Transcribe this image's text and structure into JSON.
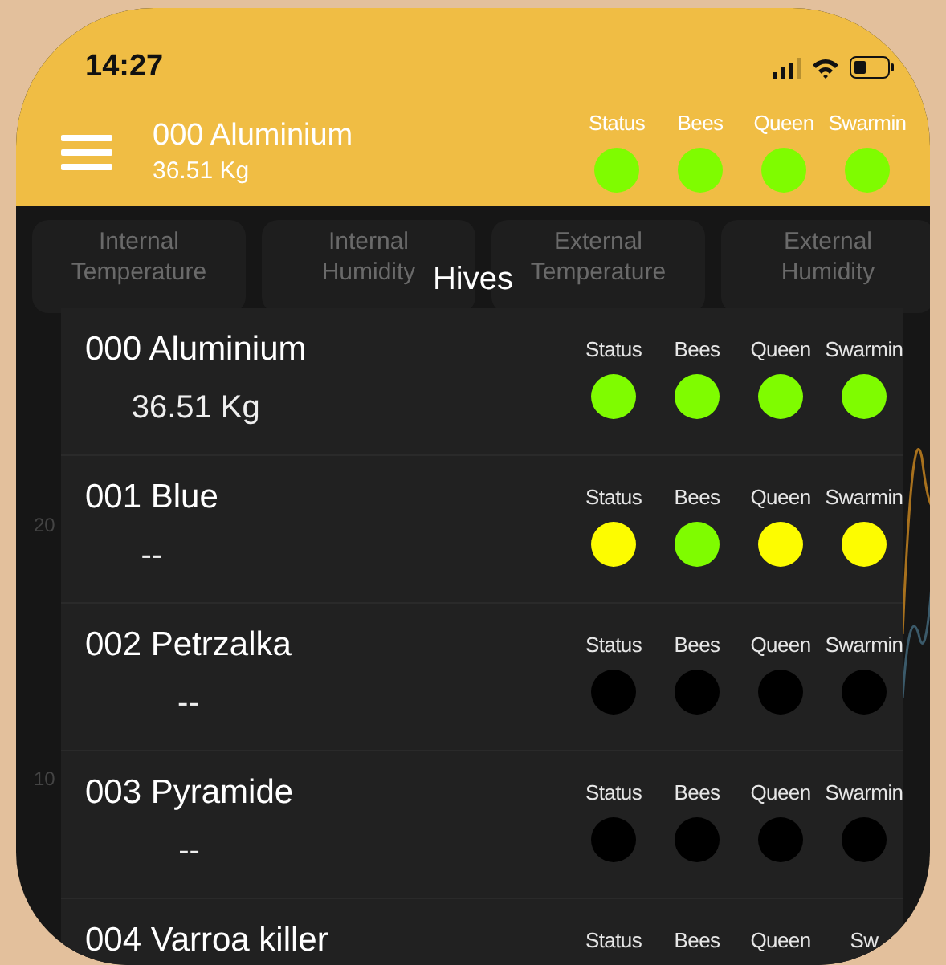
{
  "status_bar": {
    "time": "14:27"
  },
  "header": {
    "hive_name": "000 Aluminium",
    "weight": "36.51 Kg",
    "indicators": [
      {
        "label": "Status",
        "color": "#7ffc00"
      },
      {
        "label": "Bees",
        "color": "#7ffc00"
      },
      {
        "label": "Queen",
        "color": "#7ffc00"
      },
      {
        "label": "Swarmin",
        "color": "#7ffc00"
      }
    ]
  },
  "sensor_cards": [
    {
      "label": "Internal Temperature"
    },
    {
      "label": "Internal Humidity"
    },
    {
      "label": "External Temperature"
    },
    {
      "label": "External Humidity"
    }
  ],
  "chart": {
    "axis_labels": [
      "20",
      "10"
    ]
  },
  "hives_dialog": {
    "title": "Hives",
    "hives": [
      {
        "name": "000 Aluminium",
        "weight": "36.51 Kg",
        "indicators": [
          {
            "label": "Status",
            "color": "#7ffc00"
          },
          {
            "label": "Bees",
            "color": "#7ffc00"
          },
          {
            "label": "Queen",
            "color": "#7ffc00"
          },
          {
            "label": "Swarmin",
            "color": "#7ffc00"
          }
        ]
      },
      {
        "name": "001 Blue",
        "weight": "--",
        "indicators": [
          {
            "label": "Status",
            "color": "#fdfc00"
          },
          {
            "label": "Bees",
            "color": "#7ffc00"
          },
          {
            "label": "Queen",
            "color": "#fdfc00"
          },
          {
            "label": "Swarmin",
            "color": "#fdfc00"
          }
        ]
      },
      {
        "name": "002 Petrzalka",
        "weight": "--",
        "indicators": [
          {
            "label": "Status",
            "color": "#000000"
          },
          {
            "label": "Bees",
            "color": "#000000"
          },
          {
            "label": "Queen",
            "color": "#000000"
          },
          {
            "label": "Swarmin",
            "color": "#000000"
          }
        ]
      },
      {
        "name": "003 Pyramide",
        "weight": "--",
        "indicators": [
          {
            "label": "Status",
            "color": "#000000"
          },
          {
            "label": "Bees",
            "color": "#000000"
          },
          {
            "label": "Queen",
            "color": "#000000"
          },
          {
            "label": "Swarmin",
            "color": "#000000"
          }
        ]
      },
      {
        "name": "004 Varroa killer",
        "indicators": [
          {
            "label": "Status"
          },
          {
            "label": "Bees"
          },
          {
            "label": "Queen"
          },
          {
            "label": "Sw"
          }
        ]
      }
    ]
  }
}
